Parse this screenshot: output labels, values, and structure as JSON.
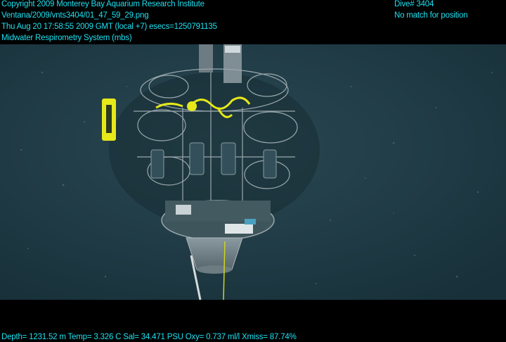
{
  "overlay": {
    "copyright": "Copyright 2009 Monterey Bay Aquarium Research Institute",
    "filename": "Ventana/2009/vnts3404/01_47_59_29.png",
    "timestamp": "Thu Aug 20 17:58:55 2009 GMT (local +7)  esecs=1250791135",
    "subject": "Midwater Respirometry System (mbs)",
    "dive": "Dive# 3404",
    "position": "No match for position",
    "sensors": "Depth= 1231.52 m  Temp= 3.326 C  Sal= 34.471 PSU  Oxy= 0.737 ml/l  Xmiss= 87.74%"
  },
  "colors": {
    "overlay_text": "#1fe0f0",
    "water": "#1f3a44",
    "instrument_yellow": "#e6e81a"
  }
}
